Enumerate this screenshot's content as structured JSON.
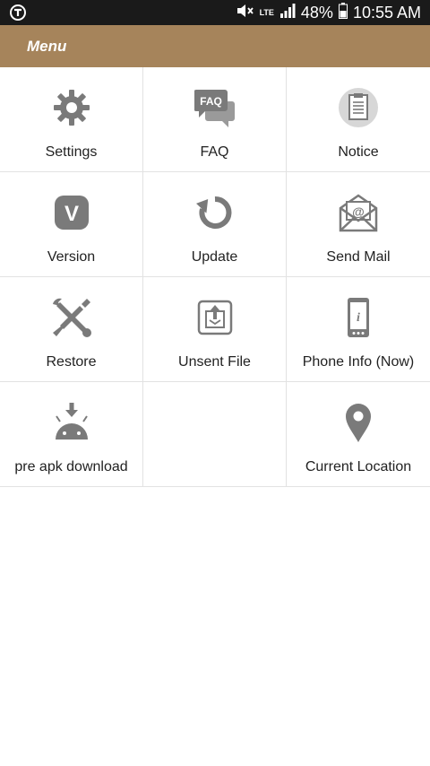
{
  "status_bar": {
    "battery": "48%",
    "time": "10:55 AM",
    "network": "LTE"
  },
  "header": {
    "title": "Menu"
  },
  "menu": {
    "items": [
      {
        "label": "Settings",
        "icon": "gear-icon"
      },
      {
        "label": "FAQ",
        "icon": "faq-icon",
        "icon_text": "FAQ"
      },
      {
        "label": "Notice",
        "icon": "notice-clipboard-icon"
      },
      {
        "label": "Version",
        "icon": "version-icon",
        "icon_text": "V"
      },
      {
        "label": "Update",
        "icon": "refresh-icon"
      },
      {
        "label": "Send Mail",
        "icon": "mail-icon",
        "icon_text": "@"
      },
      {
        "label": "Restore",
        "icon": "tools-icon"
      },
      {
        "label": "Unsent File",
        "icon": "upload-box-icon"
      },
      {
        "label": "Phone Info (Now)",
        "icon": "phone-info-icon",
        "icon_text": "i"
      },
      {
        "label": "pre apk download",
        "icon": "android-download-icon"
      },
      {
        "label": "",
        "icon": ""
      },
      {
        "label": "Current Location",
        "icon": "location-pin-icon"
      }
    ]
  },
  "colors": {
    "header": "#a6845b",
    "icon": "#7a7a7a",
    "status_bar": "#1a1a1a"
  }
}
